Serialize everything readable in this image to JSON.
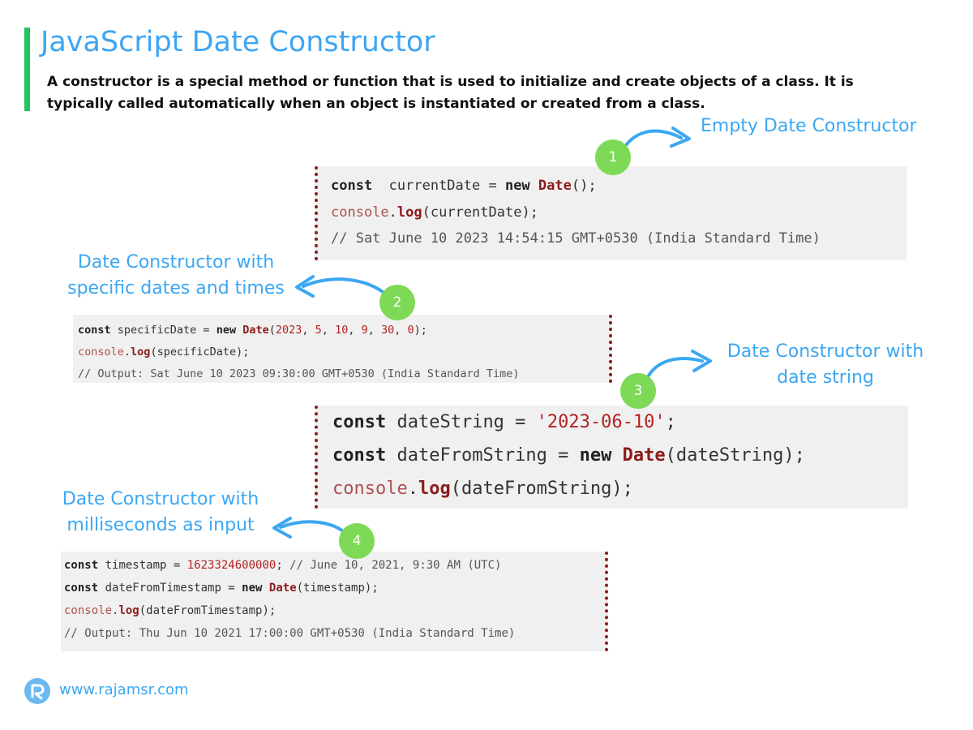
{
  "title": "JavaScript Date Constructor",
  "description": "A constructor is a special method or function that is used to initialize and create objects of a class. It is typically called automatically when an object is instantiated or created from a class.",
  "sections": [
    {
      "number": "1",
      "label_lines": [
        "Empty Date Constructor"
      ],
      "code": [
        [
          [
            "kw",
            "const"
          ],
          [
            "",
            "  currentDate = "
          ],
          [
            "kw",
            "new"
          ],
          [
            "",
            " "
          ],
          [
            "cls",
            "Date"
          ],
          [
            "",
            "();"
          ]
        ],
        [
          [
            "cons",
            "console"
          ],
          [
            "",
            "."
          ],
          [
            "mth",
            "log"
          ],
          [
            "",
            "(currentDate);"
          ]
        ],
        [
          [
            "cmt",
            "// Sat June 10 2023 14:54:15 GMT+0530 (India Standard Time)"
          ]
        ]
      ]
    },
    {
      "number": "2",
      "label_lines": [
        "Date Constructor with",
        "specific dates and times"
      ],
      "code": [
        [
          [
            "kw",
            "const"
          ],
          [
            "",
            " specificDate = "
          ],
          [
            "kw",
            "new"
          ],
          [
            "",
            " "
          ],
          [
            "cls",
            "Date"
          ],
          [
            "",
            "("
          ],
          [
            "num",
            "2023"
          ],
          [
            "",
            ", "
          ],
          [
            "num",
            "5"
          ],
          [
            "",
            ", "
          ],
          [
            "num",
            "10"
          ],
          [
            "",
            ", "
          ],
          [
            "num",
            "9"
          ],
          [
            "",
            ", "
          ],
          [
            "num",
            "30"
          ],
          [
            "",
            ", "
          ],
          [
            "num",
            "0"
          ],
          [
            "",
            ");"
          ]
        ],
        [
          [
            "cons",
            "console"
          ],
          [
            "",
            "."
          ],
          [
            "mth",
            "log"
          ],
          [
            "",
            "(specificDate);"
          ]
        ],
        [
          [
            "cmt",
            "// Output: Sat June 10 2023 09:30:00 GMT+0530 (India Standard Time)"
          ]
        ]
      ]
    },
    {
      "number": "3",
      "label_lines": [
        "Date Constructor with",
        "date string"
      ],
      "code": [
        [
          [
            "kw",
            "const"
          ],
          [
            "",
            " dateString = "
          ],
          [
            "str",
            "'2023-06-10'"
          ],
          [
            "",
            ";"
          ]
        ],
        [
          [
            "kw",
            "const"
          ],
          [
            "",
            " dateFromString = "
          ],
          [
            "kw",
            "new"
          ],
          [
            "",
            " "
          ],
          [
            "cls",
            "Date"
          ],
          [
            "",
            "(dateString);"
          ]
        ],
        [
          [
            "cons",
            "console"
          ],
          [
            "",
            "."
          ],
          [
            "mth",
            "log"
          ],
          [
            "",
            "(dateFromString);"
          ]
        ]
      ]
    },
    {
      "number": "4",
      "label_lines": [
        "Date Constructor with",
        "milliseconds as input"
      ],
      "code": [
        [
          [
            "kw",
            "const"
          ],
          [
            "",
            " timestamp = "
          ],
          [
            "num",
            "1623324600000"
          ],
          [
            "",
            "; "
          ],
          [
            "cmt",
            "// June 10, 2021, 9:30 AM (UTC)"
          ]
        ],
        [
          [
            "kw",
            "const"
          ],
          [
            "",
            " dateFromTimestamp = "
          ],
          [
            "kw",
            "new"
          ],
          [
            "",
            " "
          ],
          [
            "cls",
            "Date"
          ],
          [
            "",
            "(timestamp);"
          ]
        ],
        [
          [
            "cons",
            "console"
          ],
          [
            "",
            "."
          ],
          [
            "mth",
            "log"
          ],
          [
            "",
            "(dateFromTimestamp);"
          ]
        ],
        [
          [
            "cmt",
            "// Output: Thu Jun 10 2021 17:00:00 GMT+0530 (India Standard Time)"
          ]
        ]
      ]
    }
  ],
  "footer": {
    "website": "www.rajamsr.com",
    "logo_icon": "rajamsr-logo-icon"
  },
  "colors": {
    "accent": "#22c55e",
    "title": "#3da5f4",
    "badge": "#7ed957",
    "arrow": "#3ba7f2",
    "code_border": "#8b1c1c"
  }
}
